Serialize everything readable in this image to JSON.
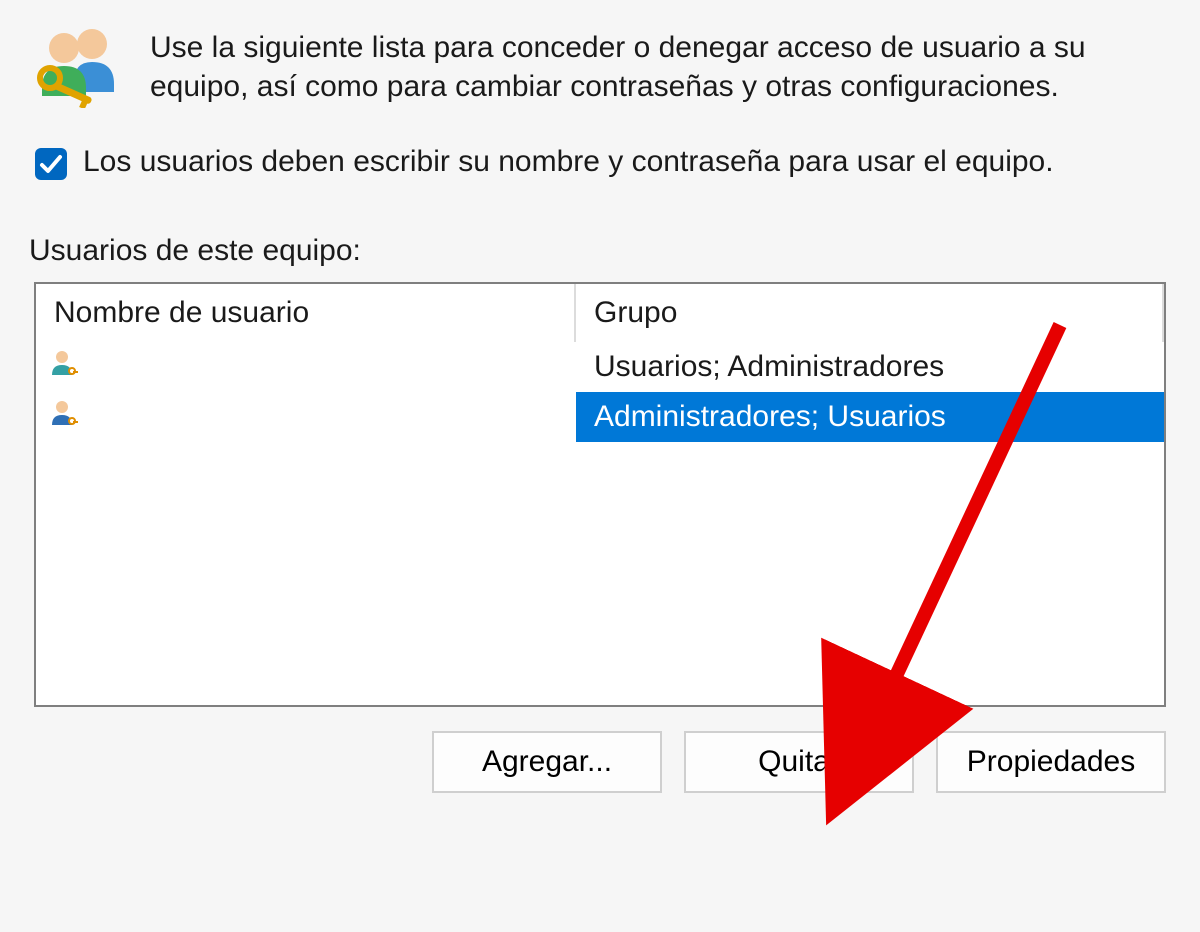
{
  "intro": {
    "text": "Use la siguiente lista para conceder o denegar acceso de usuario a su equipo, así como para cambiar contraseñas y otras configuraciones."
  },
  "require_login": {
    "checked": true,
    "label": "Los usuarios deben escribir su nombre y contraseña para usar el equipo."
  },
  "list": {
    "heading": "Usuarios de este equipo:",
    "columns": {
      "user": "Nombre de usuario",
      "group": "Grupo"
    },
    "rows": [
      {
        "username": "",
        "group": "Usuarios; Administradores",
        "selected": false
      },
      {
        "username": "",
        "group": "Administradores; Usuarios",
        "selected": true
      }
    ]
  },
  "buttons": {
    "add": "Agregar...",
    "remove": "Quitar",
    "properties": "Propiedades"
  },
  "annotation": {
    "type": "arrow",
    "color": "#e60000",
    "target": "remove-button"
  }
}
